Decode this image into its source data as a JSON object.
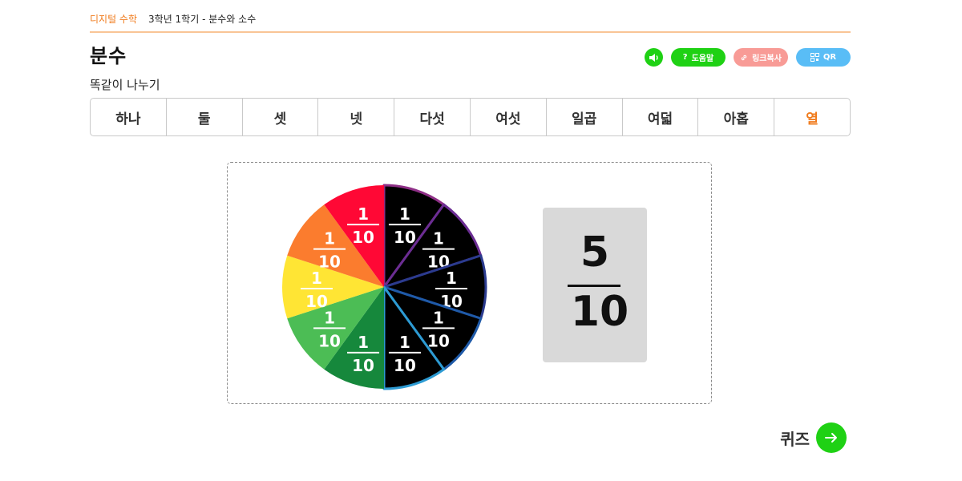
{
  "breadcrumb": {
    "app": "디지털 수학",
    "path": "3학년 1학기 - 분수와 소수"
  },
  "page": {
    "title": "분수",
    "subtitle": "똑같이 나누기"
  },
  "toolbar": {
    "sound_icon": "speaker-icon",
    "help_label": "도움말",
    "link_label": "링크복사",
    "qr_label": "QR",
    "colors": {
      "green": "#1fd114",
      "pink": "#f89b96",
      "blue": "#59bdf6"
    }
  },
  "tabs": [
    {
      "label": "하나"
    },
    {
      "label": "둘"
    },
    {
      "label": "셋"
    },
    {
      "label": "넷"
    },
    {
      "label": "다섯"
    },
    {
      "label": "여섯"
    },
    {
      "label": "일곱"
    },
    {
      "label": "여덟"
    },
    {
      "label": "아홉"
    },
    {
      "label": "열"
    }
  ],
  "active_tab": 9,
  "pie": {
    "slices": 10,
    "slice_label": {
      "numerator": "1",
      "denominator": "10"
    },
    "selected_slices": [
      0,
      1,
      2,
      3,
      4
    ],
    "slice_colors": [
      "#000000",
      "#000000",
      "#000000",
      "#000000",
      "#000000",
      "#16883c",
      "#4cbd55",
      "#ffe534",
      "#fb7c2e",
      "#ff0835"
    ],
    "selected_outline_colors": [
      "#8e2f86",
      "#6b2d93",
      "#2b3b8f",
      "#1f5aa8",
      "#2d9bd3"
    ]
  },
  "fraction": {
    "numerator": "5",
    "denominator": "10"
  },
  "quiz": {
    "label": "퀴즈"
  }
}
